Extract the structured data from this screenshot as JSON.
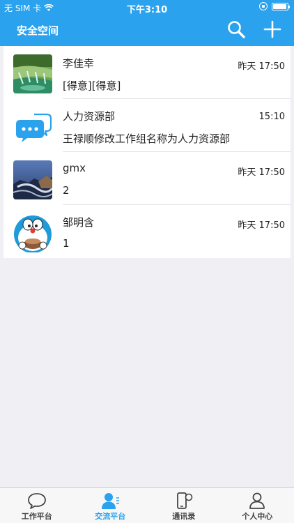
{
  "status_bar": {
    "carrier": "无 SIM 卡",
    "time": "下午3:10"
  },
  "nav": {
    "title": "安全空间"
  },
  "conversations": [
    {
      "name": "李佳幸",
      "time": "昨天 17:50",
      "message": "[得意][得意]",
      "avatar": "waterfall-photo"
    },
    {
      "name": "人力资源部",
      "time": "15:10",
      "message": "王禄顺修改工作组名称为人力资源部",
      "avatar": "group-chat-icon"
    },
    {
      "name": "gmx",
      "time": "昨天 17:50",
      "message": "2",
      "avatar": "coastal-rock-photo"
    },
    {
      "name": "邹明含",
      "time": "昨天 17:50",
      "message": "1",
      "avatar": "doraemon-avatar"
    }
  ],
  "tabs": [
    {
      "label": "工作平台",
      "icon": "chat-bubble-icon",
      "active": false
    },
    {
      "label": "交流平台",
      "icon": "person-chat-icon",
      "active": true
    },
    {
      "label": "通讯录",
      "icon": "phone-contacts-icon",
      "active": false
    },
    {
      "label": "个人中心",
      "icon": "person-icon",
      "active": false
    }
  ],
  "colors": {
    "accent": "#2aa2ee",
    "background": "#efeff4",
    "tab_inactive": "#444444"
  }
}
